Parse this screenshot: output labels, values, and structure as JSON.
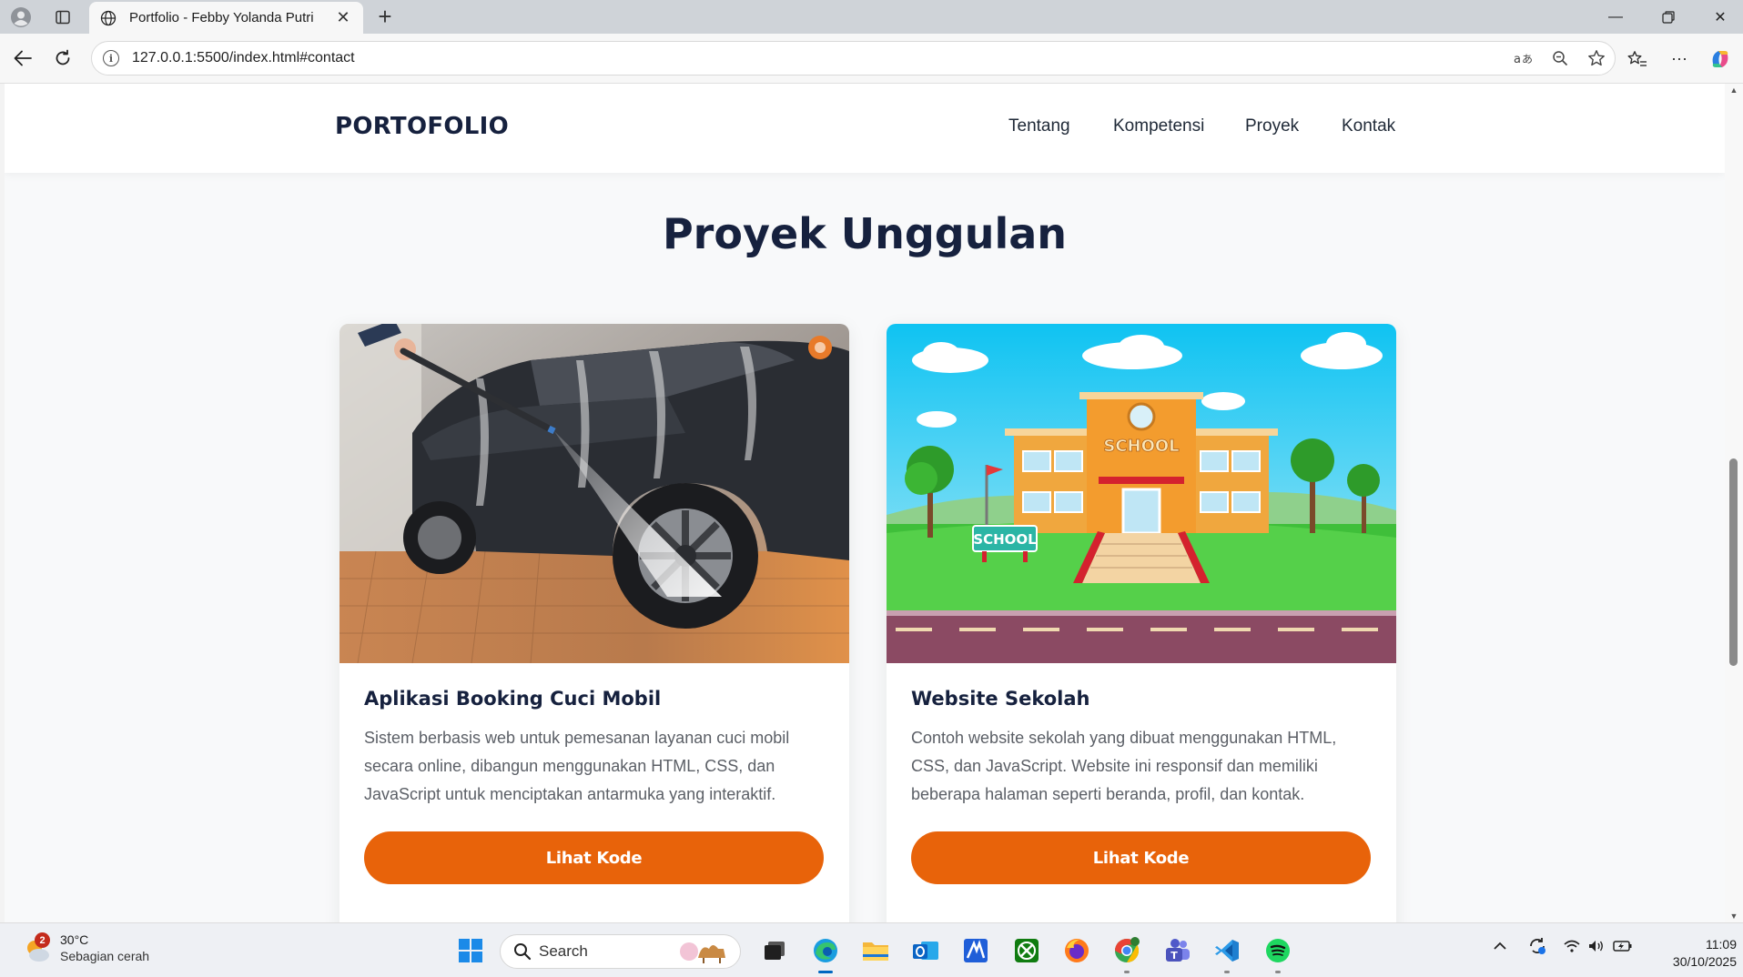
{
  "browser": {
    "tab_title": "Portfolio - Febby Yolanda Putri",
    "url": "127.0.0.1:5500/index.html#contact"
  },
  "site": {
    "brand": "PORTOFOLIO",
    "nav": [
      "Tentang",
      "Kompetensi",
      "Proyek",
      "Kontak"
    ],
    "section_title": "Proyek Unggulan",
    "projects": [
      {
        "title": "Aplikasi Booking Cuci Mobil",
        "description": "Sistem berbasis web untuk pemesanan layanan cuci mobil secara online, dibangun menggunakan HTML, CSS, dan JavaScript untuk menciptakan antarmuka yang interaktif.",
        "button": "Lihat Kode",
        "image": "car-wash-photo"
      },
      {
        "title": "Website Sekolah",
        "description": "Contoh website sekolah yang dibuat menggunakan HTML, CSS, dan JavaScript. Website ini responsif dan memiliki beberapa halaman seperti beranda, profil, dan kontak.",
        "button": "Lihat Kode",
        "image": "school-illustration",
        "image_text": [
          "SCHOOL",
          "SCHOOL"
        ]
      }
    ],
    "accent_color": "#e8630a",
    "heading_color": "#16213e"
  },
  "taskbar": {
    "weather": {
      "badge": "2",
      "temp": "30°C",
      "condition": "Sebagian cerah"
    },
    "search_placeholder": "Search",
    "clock": {
      "time": "11:09",
      "date": "30/10/2025"
    }
  }
}
